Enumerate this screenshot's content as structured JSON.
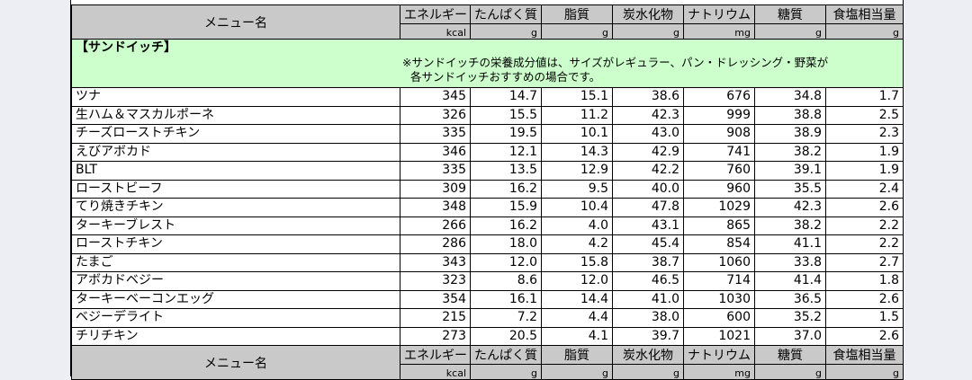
{
  "columns": [
    {
      "label": "メニュー名",
      "unit": ""
    },
    {
      "label": "エネルギー",
      "unit": "kcal"
    },
    {
      "label": "たんぱく質",
      "unit": "g"
    },
    {
      "label": "脂質",
      "unit": "g"
    },
    {
      "label": "炭水化物",
      "unit": "g"
    },
    {
      "label": "ナトリウム",
      "unit": "mg"
    },
    {
      "label": "糖質",
      "unit": "g"
    },
    {
      "label": "食塩相当量",
      "unit": "g"
    }
  ],
  "section": {
    "title": "【サンドイッチ】",
    "note_line1": "※サンドイッチの栄養成分値は、サイズがレギュラー、パン・ドレッシング・野菜が",
    "note_line2": "各サンドイッチおすすめの場合です。"
  },
  "rows": [
    [
      "ツナ",
      "345",
      "14.7",
      "15.1",
      "38.6",
      "676",
      "34.8",
      "1.7"
    ],
    [
      "生ハム＆マスカルポーネ",
      "326",
      "15.5",
      "11.2",
      "42.3",
      "999",
      "38.8",
      "2.5"
    ],
    [
      "チーズローストチキン",
      "335",
      "19.5",
      "10.1",
      "43.0",
      "908",
      "38.9",
      "2.3"
    ],
    [
      "えびアボカド",
      "346",
      "12.1",
      "14.3",
      "42.9",
      "741",
      "38.2",
      "1.9"
    ],
    [
      "BLT",
      "335",
      "13.5",
      "12.9",
      "42.2",
      "760",
      "39.1",
      "1.9"
    ],
    [
      "ローストビーフ",
      "309",
      "16.2",
      "9.5",
      "40.0",
      "960",
      "35.5",
      "2.4"
    ],
    [
      "てり焼きチキン",
      "348",
      "15.9",
      "10.4",
      "47.8",
      "1029",
      "42.3",
      "2.6"
    ],
    [
      "ターキーブレスト",
      "266",
      "16.2",
      "4.0",
      "43.1",
      "865",
      "38.2",
      "2.2"
    ],
    [
      "ローストチキン",
      "286",
      "18.0",
      "4.2",
      "45.4",
      "854",
      "41.1",
      "2.2"
    ],
    [
      "たまご",
      "343",
      "12.0",
      "15.8",
      "38.7",
      "1060",
      "33.8",
      "2.7"
    ],
    [
      "アボカドベジー",
      "323",
      "8.6",
      "12.0",
      "46.5",
      "714",
      "41.4",
      "1.8"
    ],
    [
      "ターキーベーコンエッグ",
      "354",
      "16.1",
      "14.4",
      "41.0",
      "1030",
      "36.5",
      "2.6"
    ],
    [
      "ベジーデライト",
      "215",
      "7.2",
      "4.4",
      "38.0",
      "600",
      "35.2",
      "1.5"
    ],
    [
      "チリチキン",
      "273",
      "20.5",
      "4.1",
      "39.7",
      "1021",
      "37.0",
      "2.6"
    ]
  ]
}
